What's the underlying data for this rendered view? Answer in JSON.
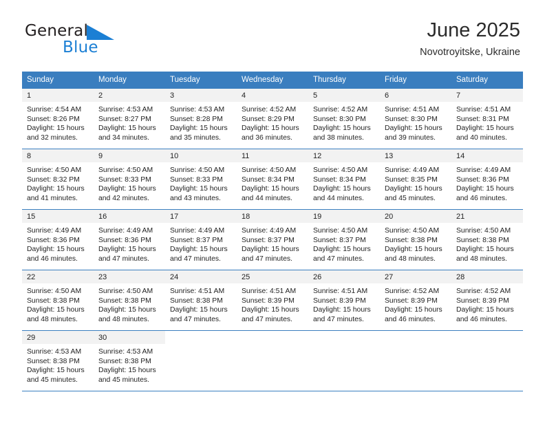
{
  "brand": {
    "name_part1": "General",
    "name_part2": "Blue",
    "triangle_color": "#1b7fd4",
    "icon": "triangle-logo-icon"
  },
  "header": {
    "title": "June 2025",
    "subtitle": "Novotroyitske, Ukraine"
  },
  "theme": {
    "header_bg": "#3a7ebf",
    "header_text": "#ffffff",
    "daynum_bg": "#f2f2f2",
    "cell_bg": "#ffffff",
    "text": "#222222"
  },
  "calendar": {
    "weekday_headers": [
      "Sunday",
      "Monday",
      "Tuesday",
      "Wednesday",
      "Thursday",
      "Friday",
      "Saturday"
    ],
    "weeks": [
      [
        {
          "day": "1",
          "sunrise": "Sunrise: 4:54 AM",
          "sunset": "Sunset: 8:26 PM",
          "daylight_line1": "Daylight: 15 hours",
          "daylight_line2": "and 32 minutes."
        },
        {
          "day": "2",
          "sunrise": "Sunrise: 4:53 AM",
          "sunset": "Sunset: 8:27 PM",
          "daylight_line1": "Daylight: 15 hours",
          "daylight_line2": "and 34 minutes."
        },
        {
          "day": "3",
          "sunrise": "Sunrise: 4:53 AM",
          "sunset": "Sunset: 8:28 PM",
          "daylight_line1": "Daylight: 15 hours",
          "daylight_line2": "and 35 minutes."
        },
        {
          "day": "4",
          "sunrise": "Sunrise: 4:52 AM",
          "sunset": "Sunset: 8:29 PM",
          "daylight_line1": "Daylight: 15 hours",
          "daylight_line2": "and 36 minutes."
        },
        {
          "day": "5",
          "sunrise": "Sunrise: 4:52 AM",
          "sunset": "Sunset: 8:30 PM",
          "daylight_line1": "Daylight: 15 hours",
          "daylight_line2": "and 38 minutes."
        },
        {
          "day": "6",
          "sunrise": "Sunrise: 4:51 AM",
          "sunset": "Sunset: 8:30 PM",
          "daylight_line1": "Daylight: 15 hours",
          "daylight_line2": "and 39 minutes."
        },
        {
          "day": "7",
          "sunrise": "Sunrise: 4:51 AM",
          "sunset": "Sunset: 8:31 PM",
          "daylight_line1": "Daylight: 15 hours",
          "daylight_line2": "and 40 minutes."
        }
      ],
      [
        {
          "day": "8",
          "sunrise": "Sunrise: 4:50 AM",
          "sunset": "Sunset: 8:32 PM",
          "daylight_line1": "Daylight: 15 hours",
          "daylight_line2": "and 41 minutes."
        },
        {
          "day": "9",
          "sunrise": "Sunrise: 4:50 AM",
          "sunset": "Sunset: 8:33 PM",
          "daylight_line1": "Daylight: 15 hours",
          "daylight_line2": "and 42 minutes."
        },
        {
          "day": "10",
          "sunrise": "Sunrise: 4:50 AM",
          "sunset": "Sunset: 8:33 PM",
          "daylight_line1": "Daylight: 15 hours",
          "daylight_line2": "and 43 minutes."
        },
        {
          "day": "11",
          "sunrise": "Sunrise: 4:50 AM",
          "sunset": "Sunset: 8:34 PM",
          "daylight_line1": "Daylight: 15 hours",
          "daylight_line2": "and 44 minutes."
        },
        {
          "day": "12",
          "sunrise": "Sunrise: 4:50 AM",
          "sunset": "Sunset: 8:34 PM",
          "daylight_line1": "Daylight: 15 hours",
          "daylight_line2": "and 44 minutes."
        },
        {
          "day": "13",
          "sunrise": "Sunrise: 4:49 AM",
          "sunset": "Sunset: 8:35 PM",
          "daylight_line1": "Daylight: 15 hours",
          "daylight_line2": "and 45 minutes."
        },
        {
          "day": "14",
          "sunrise": "Sunrise: 4:49 AM",
          "sunset": "Sunset: 8:36 PM",
          "daylight_line1": "Daylight: 15 hours",
          "daylight_line2": "and 46 minutes."
        }
      ],
      [
        {
          "day": "15",
          "sunrise": "Sunrise: 4:49 AM",
          "sunset": "Sunset: 8:36 PM",
          "daylight_line1": "Daylight: 15 hours",
          "daylight_line2": "and 46 minutes."
        },
        {
          "day": "16",
          "sunrise": "Sunrise: 4:49 AM",
          "sunset": "Sunset: 8:36 PM",
          "daylight_line1": "Daylight: 15 hours",
          "daylight_line2": "and 47 minutes."
        },
        {
          "day": "17",
          "sunrise": "Sunrise: 4:49 AM",
          "sunset": "Sunset: 8:37 PM",
          "daylight_line1": "Daylight: 15 hours",
          "daylight_line2": "and 47 minutes."
        },
        {
          "day": "18",
          "sunrise": "Sunrise: 4:49 AM",
          "sunset": "Sunset: 8:37 PM",
          "daylight_line1": "Daylight: 15 hours",
          "daylight_line2": "and 47 minutes."
        },
        {
          "day": "19",
          "sunrise": "Sunrise: 4:50 AM",
          "sunset": "Sunset: 8:37 PM",
          "daylight_line1": "Daylight: 15 hours",
          "daylight_line2": "and 47 minutes."
        },
        {
          "day": "20",
          "sunrise": "Sunrise: 4:50 AM",
          "sunset": "Sunset: 8:38 PM",
          "daylight_line1": "Daylight: 15 hours",
          "daylight_line2": "and 48 minutes."
        },
        {
          "day": "21",
          "sunrise": "Sunrise: 4:50 AM",
          "sunset": "Sunset: 8:38 PM",
          "daylight_line1": "Daylight: 15 hours",
          "daylight_line2": "and 48 minutes."
        }
      ],
      [
        {
          "day": "22",
          "sunrise": "Sunrise: 4:50 AM",
          "sunset": "Sunset: 8:38 PM",
          "daylight_line1": "Daylight: 15 hours",
          "daylight_line2": "and 48 minutes."
        },
        {
          "day": "23",
          "sunrise": "Sunrise: 4:50 AM",
          "sunset": "Sunset: 8:38 PM",
          "daylight_line1": "Daylight: 15 hours",
          "daylight_line2": "and 48 minutes."
        },
        {
          "day": "24",
          "sunrise": "Sunrise: 4:51 AM",
          "sunset": "Sunset: 8:38 PM",
          "daylight_line1": "Daylight: 15 hours",
          "daylight_line2": "and 47 minutes."
        },
        {
          "day": "25",
          "sunrise": "Sunrise: 4:51 AM",
          "sunset": "Sunset: 8:39 PM",
          "daylight_line1": "Daylight: 15 hours",
          "daylight_line2": "and 47 minutes."
        },
        {
          "day": "26",
          "sunrise": "Sunrise: 4:51 AM",
          "sunset": "Sunset: 8:39 PM",
          "daylight_line1": "Daylight: 15 hours",
          "daylight_line2": "and 47 minutes."
        },
        {
          "day": "27",
          "sunrise": "Sunrise: 4:52 AM",
          "sunset": "Sunset: 8:39 PM",
          "daylight_line1": "Daylight: 15 hours",
          "daylight_line2": "and 46 minutes."
        },
        {
          "day": "28",
          "sunrise": "Sunrise: 4:52 AM",
          "sunset": "Sunset: 8:39 PM",
          "daylight_line1": "Daylight: 15 hours",
          "daylight_line2": "and 46 minutes."
        }
      ],
      [
        {
          "day": "29",
          "sunrise": "Sunrise: 4:53 AM",
          "sunset": "Sunset: 8:38 PM",
          "daylight_line1": "Daylight: 15 hours",
          "daylight_line2": "and 45 minutes."
        },
        {
          "day": "30",
          "sunrise": "Sunrise: 4:53 AM",
          "sunset": "Sunset: 8:38 PM",
          "daylight_line1": "Daylight: 15 hours",
          "daylight_line2": "and 45 minutes."
        },
        {
          "day": "",
          "sunrise": "",
          "sunset": "",
          "daylight_line1": "",
          "daylight_line2": ""
        },
        {
          "day": "",
          "sunrise": "",
          "sunset": "",
          "daylight_line1": "",
          "daylight_line2": ""
        },
        {
          "day": "",
          "sunrise": "",
          "sunset": "",
          "daylight_line1": "",
          "daylight_line2": ""
        },
        {
          "day": "",
          "sunrise": "",
          "sunset": "",
          "daylight_line1": "",
          "daylight_line2": ""
        },
        {
          "day": "",
          "sunrise": "",
          "sunset": "",
          "daylight_line1": "",
          "daylight_line2": ""
        }
      ]
    ]
  }
}
